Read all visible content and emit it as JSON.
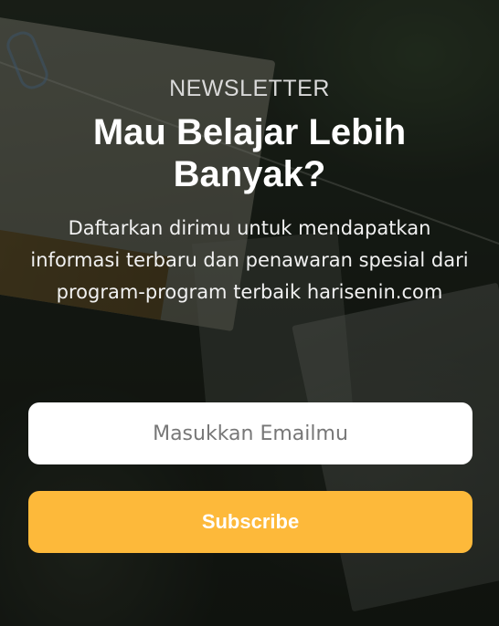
{
  "newsletter": {
    "eyebrow": "NEWSLETTER",
    "headline": "Mau Belajar Lebih Banyak?",
    "description": "Daftarkan dirimu untuk mendapatkan informasi terbaru dan penawaran spesial dari program-program terbaik harisenin.com",
    "email_placeholder": "Masukkan Emailmu",
    "email_value": "",
    "subscribe_label": "Subscribe"
  },
  "colors": {
    "accent": "#fdb93a",
    "overlay": "#0a0c0a"
  }
}
